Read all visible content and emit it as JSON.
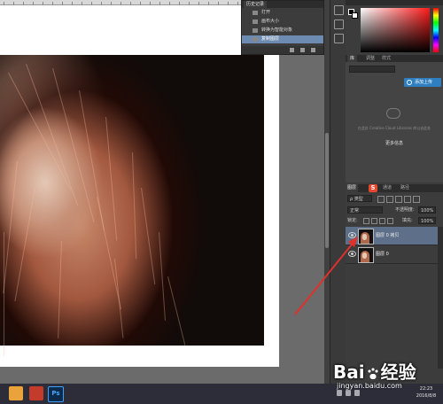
{
  "history": {
    "tab_label": "历史记录",
    "items": [
      {
        "label": "打开",
        "active": false
      },
      {
        "label": "画布大小",
        "active": false
      },
      {
        "label": "转换为智能对象",
        "active": false
      },
      {
        "label": "复制图层",
        "active": true
      }
    ]
  },
  "libraries": {
    "tabs": [
      "库",
      "调整",
      "样式"
    ],
    "upload_button": "添加上传",
    "message": "在此处 Creative Cloud Libraries 库以去此处",
    "more_link": "更多信息"
  },
  "layers": {
    "tabs": [
      "图层",
      "通道",
      "路径"
    ],
    "filter_label": "ρ 类型",
    "blend_mode": "正常",
    "opacity_label": "不透明度:",
    "opacity_value": "100%",
    "lock_label": "锁定:",
    "fill_label": "填充:",
    "fill_value": "100%",
    "items": [
      {
        "name": "图层 0 拷贝",
        "active": true
      },
      {
        "name": "图层 0",
        "active": false
      }
    ]
  },
  "taskbar": {
    "ps_label": "Ps",
    "time": "22:23",
    "date": "2016/8/8"
  },
  "watermark": {
    "logo_left": "Bai",
    "logo_right": "经验",
    "url": "jingyan.baidu.com"
  },
  "colors": {
    "selected_row": "#6d8ab0",
    "active_layer": "#5d6f89",
    "upload_button": "#2f7fc0",
    "arrow": "#e0312a"
  }
}
